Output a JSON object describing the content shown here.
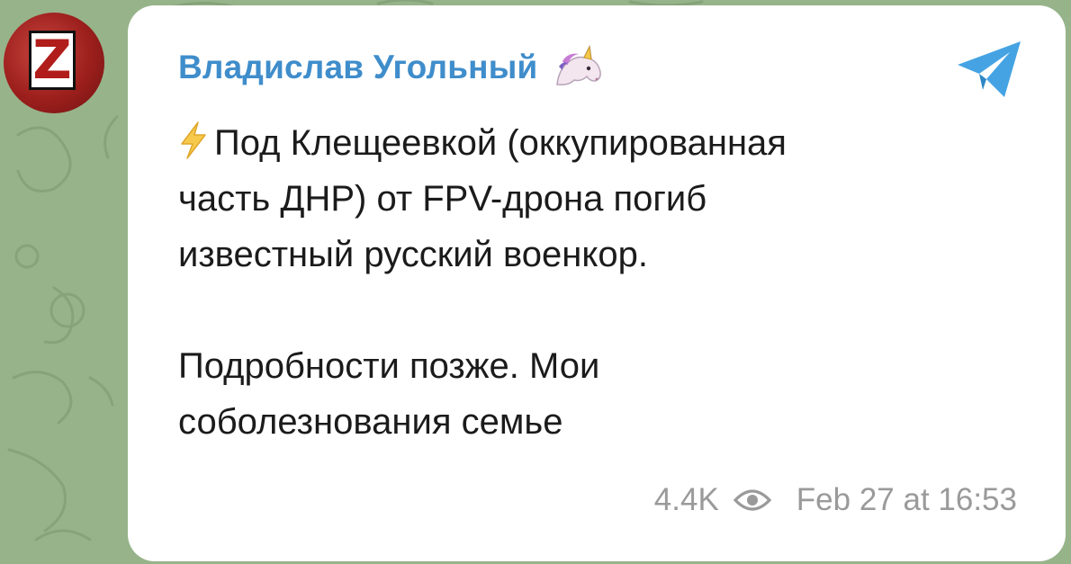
{
  "channel": {
    "author_name": "Владислав Угольный",
    "author_emoji_icon": "unicorn-icon",
    "avatar_letter": "Z"
  },
  "message": {
    "lead_icon": "lightning-bolt-icon",
    "paragraph_1_lines": [
      "Под Клещеевкой (оккупированная",
      "часть ДНР) от FPV-дрона погиб",
      "известный русский военкор."
    ],
    "paragraph_2_lines": [
      "Подробности позже. Мои",
      "соболезнования семье"
    ]
  },
  "meta": {
    "views": "4.4K",
    "views_icon": "eye-icon",
    "timestamp": "Feb 27 at 16:53"
  },
  "share": {
    "icon": "telegram-share-icon"
  },
  "colors": {
    "wallpaper": "#97b38a",
    "author": "#3f8dcb",
    "share": "#45a3e3",
    "text": "#1b1b1b",
    "meta": "#9a9a9a",
    "avatar": "#9c1f1c"
  }
}
